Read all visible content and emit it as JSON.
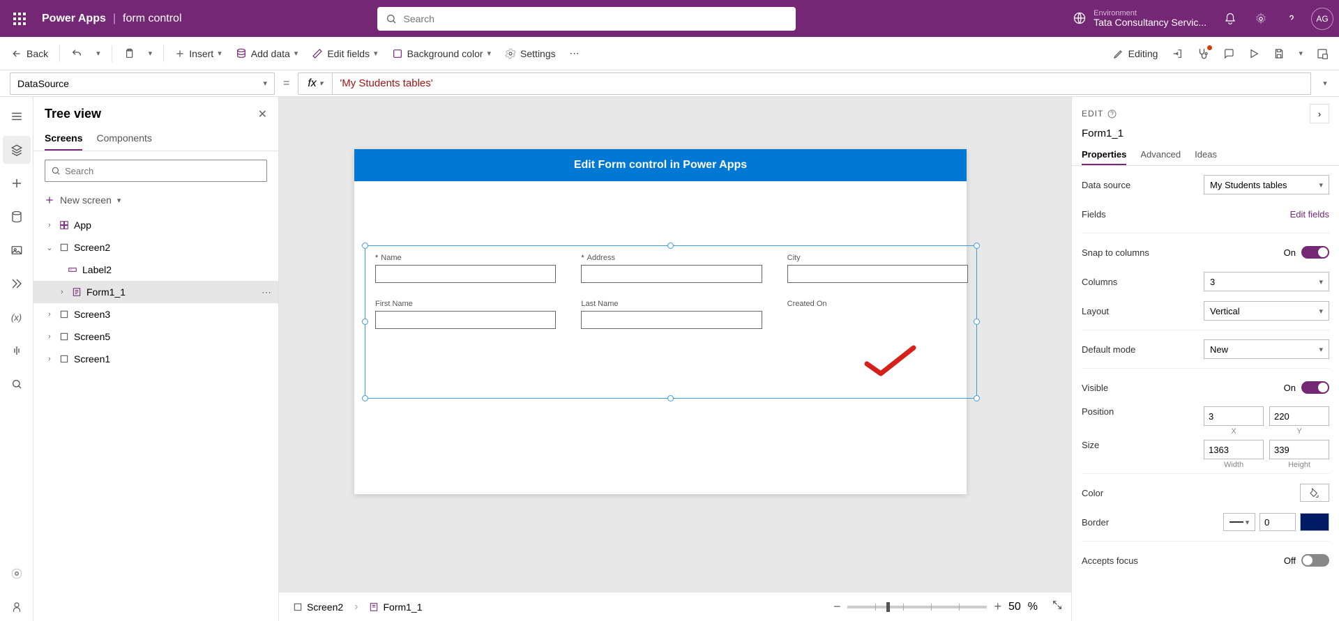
{
  "header": {
    "app_name": "Power Apps",
    "separator": "|",
    "doc_name": "form control",
    "search_placeholder": "Search",
    "env_label": "Environment",
    "env_name": "Tata Consultancy Servic...",
    "avatar_initials": "AG"
  },
  "cmdbar": {
    "back": "Back",
    "insert": "Insert",
    "add_data": "Add data",
    "edit_fields": "Edit fields",
    "bg_color": "Background color",
    "settings": "Settings",
    "editing": "Editing"
  },
  "formula": {
    "property": "DataSource",
    "fx": "fx",
    "value": "'My Students tables'"
  },
  "tree": {
    "title": "Tree view",
    "tab_screens": "Screens",
    "tab_components": "Components",
    "search_placeholder": "Search",
    "new_screen": "New screen",
    "items": {
      "app": "App",
      "screen2": "Screen2",
      "label2": "Label2",
      "form1_1": "Form1_1",
      "screen3": "Screen3",
      "screen5": "Screen5",
      "screen1": "Screen1"
    }
  },
  "canvas": {
    "title": "Edit Form control in Power Apps",
    "fields": {
      "name": "Name",
      "address": "Address",
      "city": "City",
      "first_name": "First Name",
      "last_name": "Last Name",
      "created_on": "Created On"
    }
  },
  "status": {
    "bc1": "Screen2",
    "bc2": "Form1_1",
    "zoom": "50",
    "pct": "%"
  },
  "props": {
    "edit_label": "EDIT",
    "control_name": "Form1_1",
    "tab_properties": "Properties",
    "tab_advanced": "Advanced",
    "tab_ideas": "Ideas",
    "data_source_label": "Data source",
    "data_source_value": "My Students tables",
    "fields_label": "Fields",
    "edit_fields_link": "Edit fields",
    "snap_label": "Snap to columns",
    "on_label": "On",
    "columns_label": "Columns",
    "columns_value": "3",
    "layout_label": "Layout",
    "layout_value": "Vertical",
    "default_mode_label": "Default mode",
    "default_mode_value": "New",
    "visible_label": "Visible",
    "position_label": "Position",
    "pos_x": "3",
    "pos_y": "220",
    "x_label": "X",
    "y_label": "Y",
    "size_label": "Size",
    "width": "1363",
    "height": "339",
    "width_label": "Width",
    "height_label": "Height",
    "color_label": "Color",
    "border_label": "Border",
    "border_val": "0",
    "accepts_label": "Accepts focus",
    "off_label": "Off"
  }
}
